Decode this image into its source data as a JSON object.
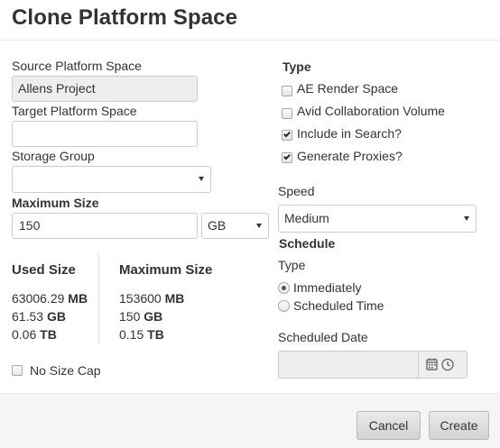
{
  "dialog": {
    "title": "Clone Platform Space"
  },
  "source": {
    "label": "Source Platform Space",
    "value": "Allens Project"
  },
  "target": {
    "label": "Target Platform Space",
    "value": ""
  },
  "storage": {
    "label": "Storage Group",
    "value": ""
  },
  "max_size": {
    "label": "Maximum Size",
    "value": "150",
    "unit": "GB"
  },
  "stats": {
    "used_header": "Used Size",
    "max_header": "Maximum Size",
    "used": [
      {
        "num": "63006.29",
        "unit": "MB"
      },
      {
        "num": "61.53",
        "unit": "GB"
      },
      {
        "num": "0.06",
        "unit": "TB"
      }
    ],
    "max": [
      {
        "num": "153600",
        "unit": "MB"
      },
      {
        "num": "150",
        "unit": "GB"
      },
      {
        "num": "0.15",
        "unit": "TB"
      }
    ]
  },
  "no_size_cap": {
    "label": "No Size Cap",
    "checked": false
  },
  "type": {
    "heading": "Type",
    "options": [
      {
        "label": "AE Render Space",
        "checked": false
      },
      {
        "label": "Avid Collaboration Volume",
        "checked": false
      },
      {
        "label": "Include in Search?",
        "checked": true
      },
      {
        "label": "Generate Proxies?",
        "checked": true
      }
    ]
  },
  "speed": {
    "label": "Speed",
    "value": "Medium"
  },
  "schedule": {
    "heading": "Schedule",
    "type_label": "Type",
    "options": [
      {
        "label": "Immediately",
        "selected": true
      },
      {
        "label": "Scheduled Time",
        "selected": false
      }
    ],
    "date_label": "Scheduled Date",
    "date_value": ""
  },
  "footer": {
    "cancel": "Cancel",
    "create": "Create"
  }
}
